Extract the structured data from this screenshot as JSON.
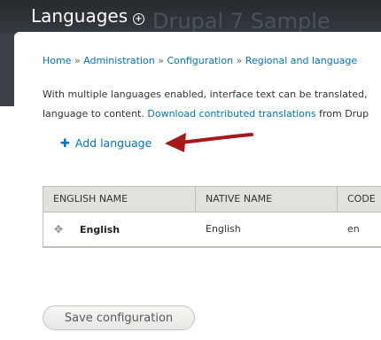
{
  "header": {
    "title": "Languages",
    "site_watermark": "Drupal 7 Sample",
    "title_icon": "plus-circle-icon"
  },
  "breadcrumb": {
    "items": [
      "Home",
      "Administration",
      "Configuration",
      "Regional and language"
    ],
    "separator": "»"
  },
  "help": {
    "line1": "With multiple languages enabled, interface text can be translated,",
    "line2_prefix": "language to content.",
    "link": "Download contributed translations",
    "line2_suffix": "from Drup"
  },
  "action": {
    "icon": "plus-icon",
    "label": "Add language"
  },
  "annotation": {
    "color": "#a8171b",
    "icon": "red-arrow"
  },
  "table": {
    "columns": [
      "ENGLISH NAME",
      "NATIVE NAME",
      "CODE"
    ],
    "rows": [
      {
        "english_name": "English",
        "native_name": "English",
        "code": "en",
        "handle_icon": "drag-handle-icon"
      }
    ]
  },
  "form": {
    "save_label": "Save configuration"
  },
  "colors": {
    "link": "#0074bd",
    "header_bg": "#3a4147",
    "table_header_bg": "#e1e2dc"
  }
}
